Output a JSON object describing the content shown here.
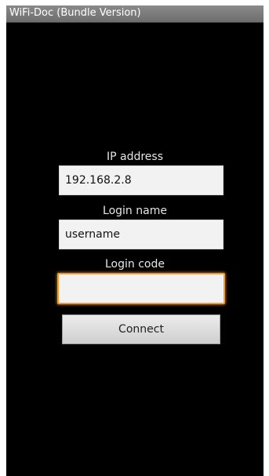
{
  "app": {
    "title": "WiFi-Doc (Bundle Version)"
  },
  "form": {
    "ip": {
      "label": "IP address",
      "value": "192.168.2.8"
    },
    "login_name": {
      "label": "Login name",
      "value": "username"
    },
    "login_code": {
      "label": "Login code",
      "value": ""
    },
    "connect_label": "Connect"
  },
  "colors": {
    "background": "#000000",
    "focus_accent": "#f29a2e",
    "field_bg": "#f2f2f2"
  }
}
